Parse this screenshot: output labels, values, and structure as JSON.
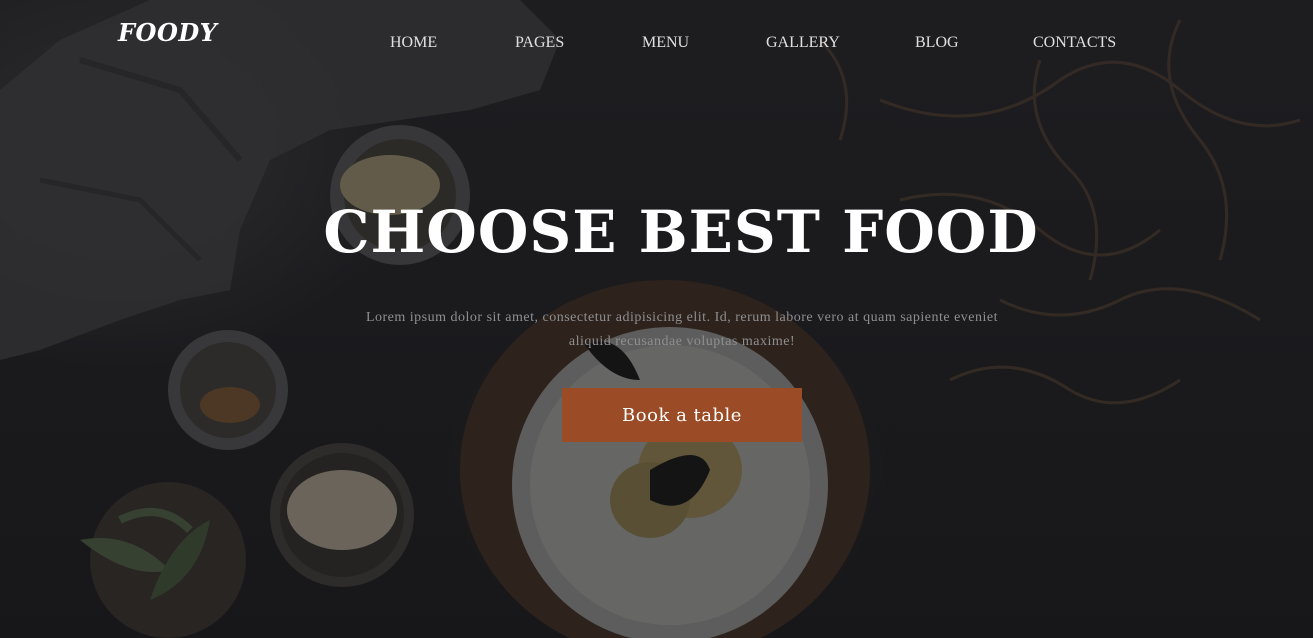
{
  "brand": {
    "logo": "FOODY"
  },
  "nav": {
    "items": [
      {
        "label": "HOME"
      },
      {
        "label": "PAGES"
      },
      {
        "label": "MENU"
      },
      {
        "label": "GALLERY"
      },
      {
        "label": "BLOG"
      },
      {
        "label": "CONTACTS"
      }
    ]
  },
  "hero": {
    "title": "CHOOSE BEST FOOD",
    "subtitle": "Lorem ipsum dolor sit amet, consectetur adipisicing elit. Id, rerum labore vero at quam sapiente eveniet aliquid recusandae voluptas maxime!",
    "cta_label": "Book a table"
  },
  "colors": {
    "accent": "#9b4b26",
    "background": "#1c1c1e",
    "heading": "#ffffff",
    "nav_text": "#e0e0e0",
    "subtitle_text": "#8f8f91"
  }
}
